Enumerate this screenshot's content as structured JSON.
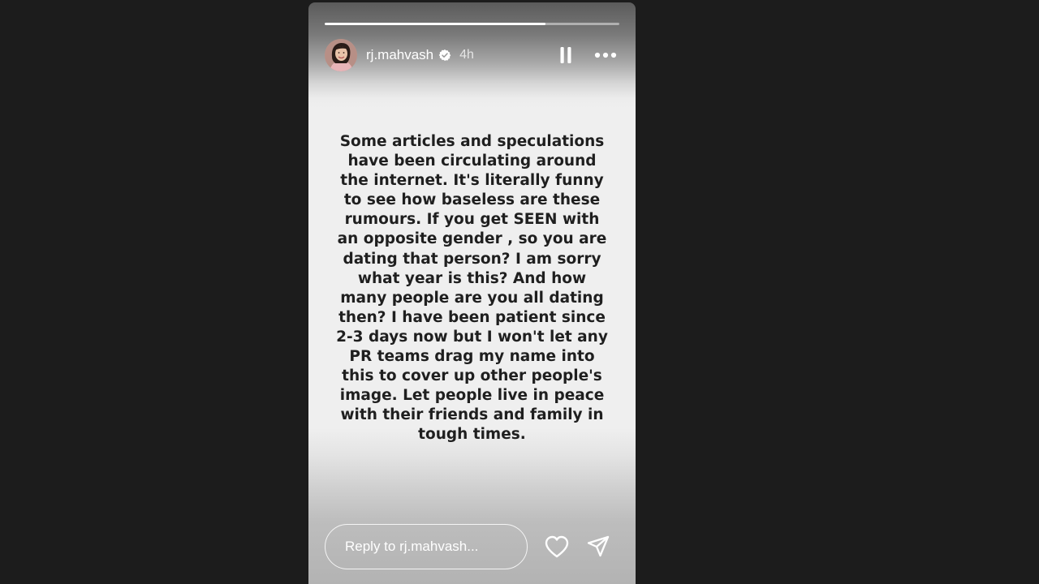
{
  "story": {
    "progress_fraction": 0.75,
    "user": {
      "username": "rj.mahvash",
      "verified": true,
      "posted_ago": "4h",
      "avatar": "profile-photo"
    },
    "controls": {
      "pause_icon": "pause-icon",
      "more_icon": "more-options-icon"
    },
    "text_lines": [
      "Some articles and speculations",
      "have been circulating around",
      "the internet. It's literally funny",
      "to see how baseless are these",
      "rumours. If you get SEEN with",
      "an opposite gender , so you are",
      "dating that person? I am sorry",
      "what year is this? And how",
      "many people are you all dating",
      "then? I have been patient since",
      "2-3 days now but I won't let any",
      "PR teams drag my name into",
      "this to cover up other people's",
      "image. Let people live in peace",
      "with their friends and family in",
      "tough times."
    ],
    "reply": {
      "placeholder": "Reply to rj.mahvash...",
      "value": ""
    },
    "actions": {
      "like_icon": "heart-icon",
      "share_icon": "send-icon"
    }
  },
  "colors": {
    "page_background": "#1c1c1c",
    "story_text": "#1f1f1f",
    "ui_foreground": "#ffffff"
  }
}
